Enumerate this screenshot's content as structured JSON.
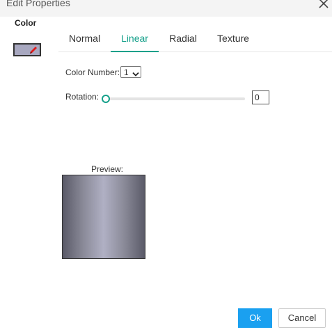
{
  "window": {
    "title": "Edit Properties",
    "close_icon": "close-icon"
  },
  "sidebar": {
    "color_label": "Color",
    "swatch_color": "#a8a8c0",
    "swatch_icon": "pencil-icon"
  },
  "tabs": [
    {
      "label": "Normal",
      "active": false
    },
    {
      "label": "Linear",
      "active": true
    },
    {
      "label": "Radial",
      "active": false
    },
    {
      "label": "Texture",
      "active": false
    }
  ],
  "linear": {
    "color_number_label": "Color Number:",
    "color_number_value": "1",
    "rotation_label": "Rotation:",
    "rotation_value": "0",
    "rotation_fraction": 0.0,
    "preview_label": "Preview:"
  },
  "colors": {
    "accent": "#15a08a",
    "primary_button": "#1aa0f0",
    "gradient_dark": "#5a5a68",
    "gradient_light": "#b0b0c4"
  },
  "footer": {
    "ok_label": "Ok",
    "cancel_label": "Cancel"
  }
}
